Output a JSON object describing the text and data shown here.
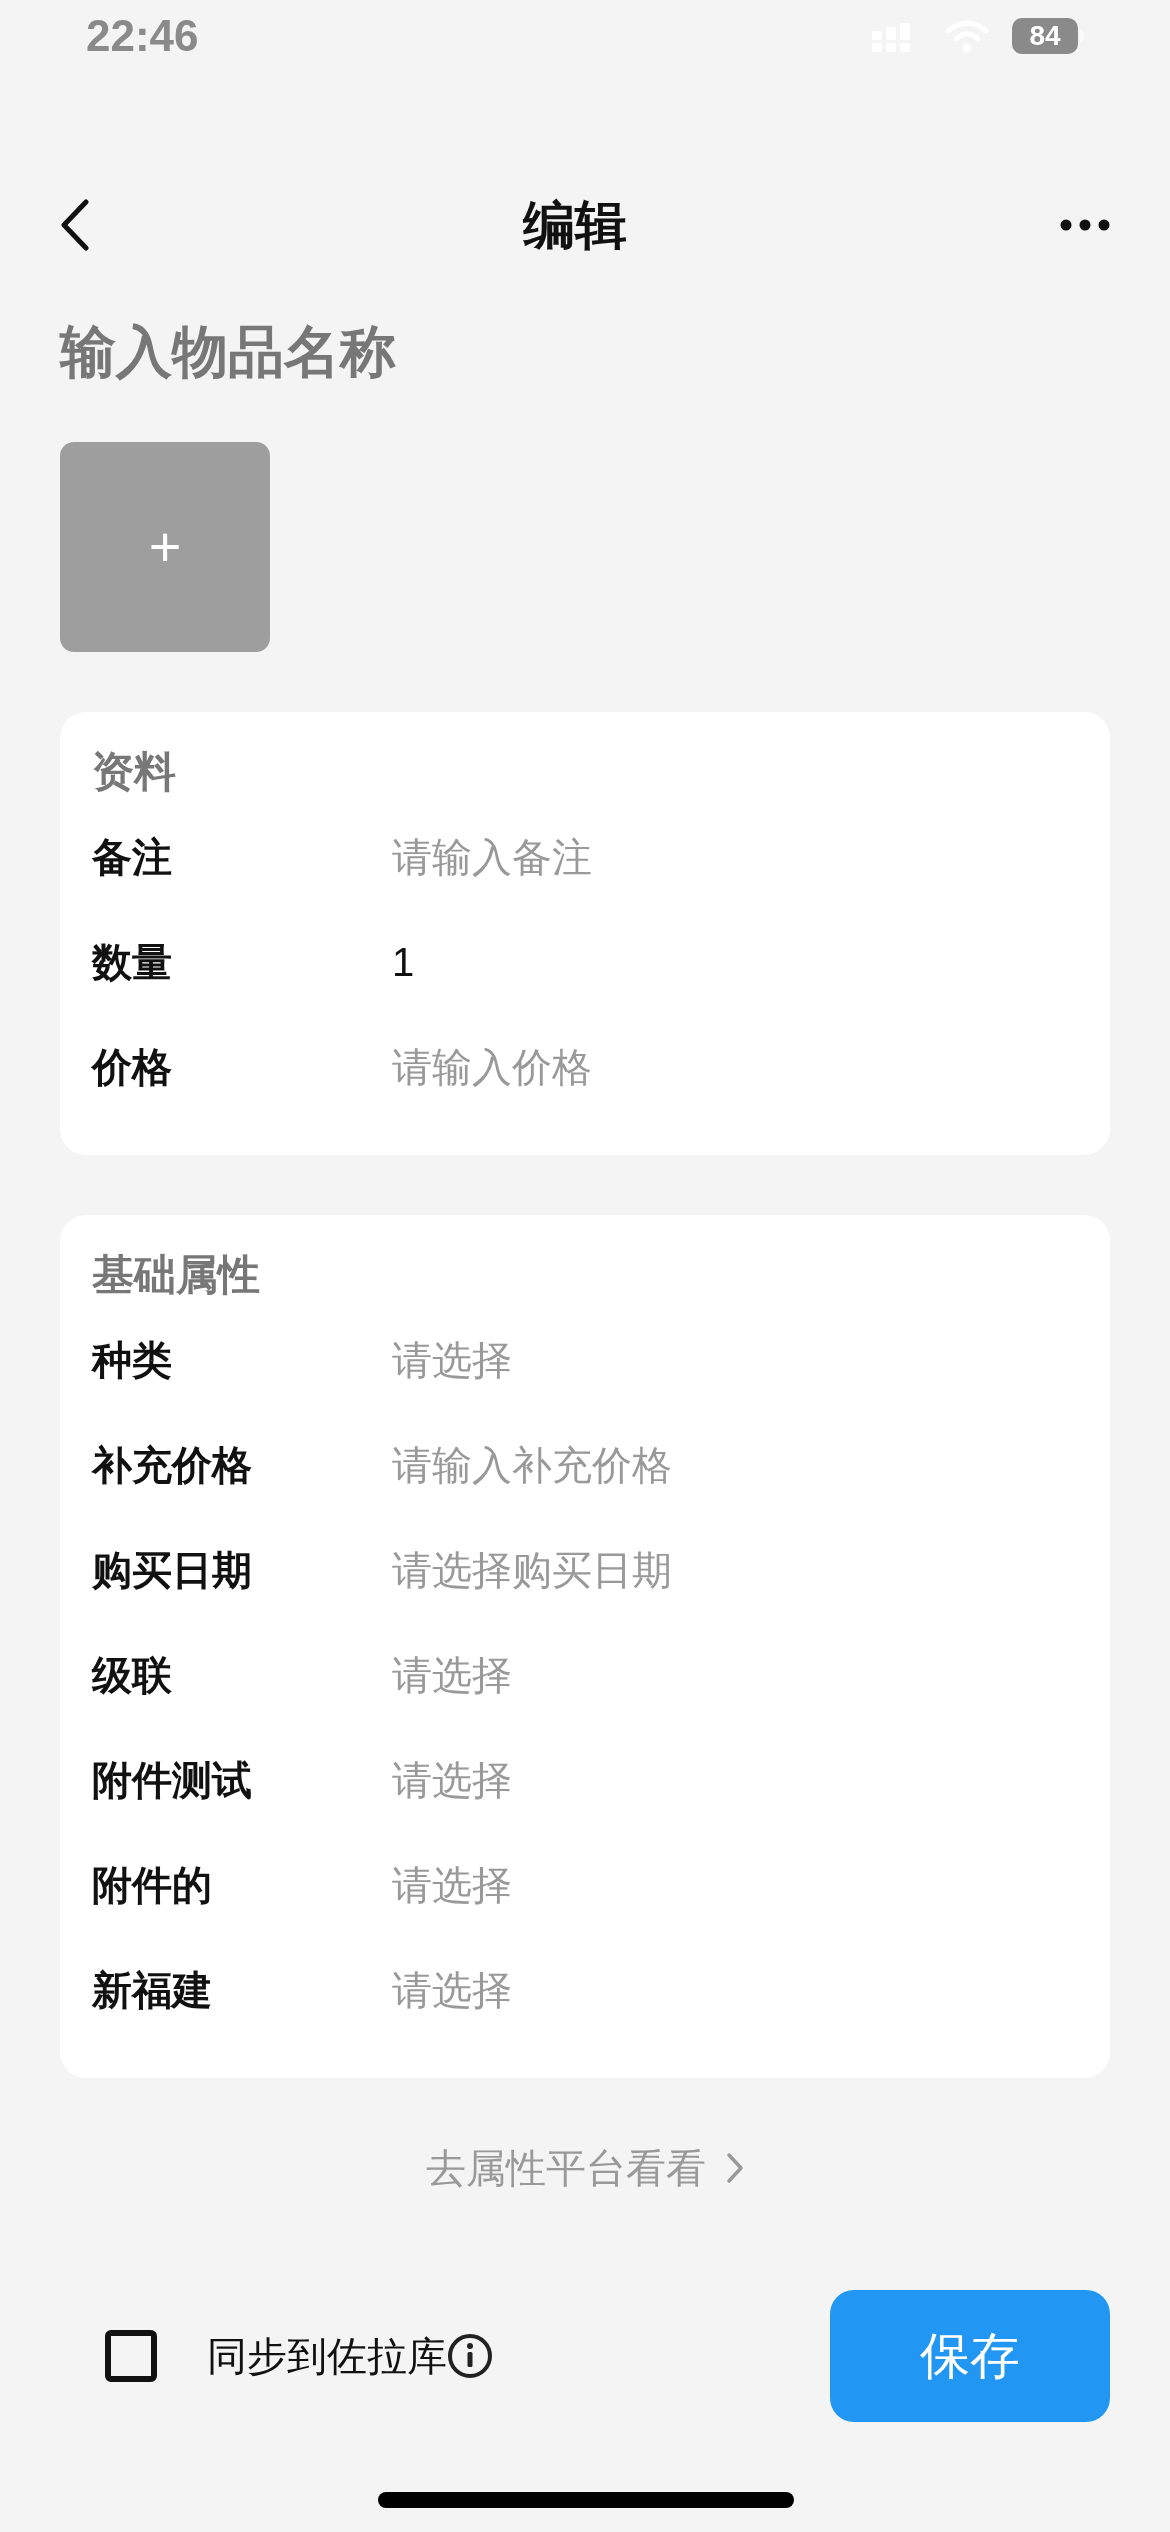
{
  "status_bar": {
    "time": "22:46",
    "battery": "84"
  },
  "nav": {
    "title": "编辑"
  },
  "name_field": {
    "placeholder": "输入物品名称"
  },
  "photo": {
    "button": "+"
  },
  "sections": [
    {
      "title": "资料",
      "fields": [
        {
          "label": "备注",
          "placeholder": "请输入备注"
        },
        {
          "label": "数量",
          "value": "1"
        },
        {
          "label": "价格",
          "placeholder": "请输入价格"
        }
      ]
    },
    {
      "title": "基础属性",
      "fields": [
        {
          "label": "种类",
          "placeholder": "请选择"
        },
        {
          "label": "补充价格",
          "placeholder": "请输入补充价格"
        },
        {
          "label": "购买日期",
          "placeholder": "请选择购买日期"
        },
        {
          "label": "级联",
          "placeholder": "请选择"
        },
        {
          "label": "附件测试",
          "placeholder": "请选择"
        },
        {
          "label": "附件的",
          "placeholder": "请选择"
        },
        {
          "label": "新福建",
          "placeholder": "请选择"
        }
      ]
    }
  ],
  "link": {
    "label": "去属性平台看看"
  },
  "footer": {
    "sync_label": "同步到佐拉库",
    "sync_checked": false,
    "save": "保存"
  }
}
